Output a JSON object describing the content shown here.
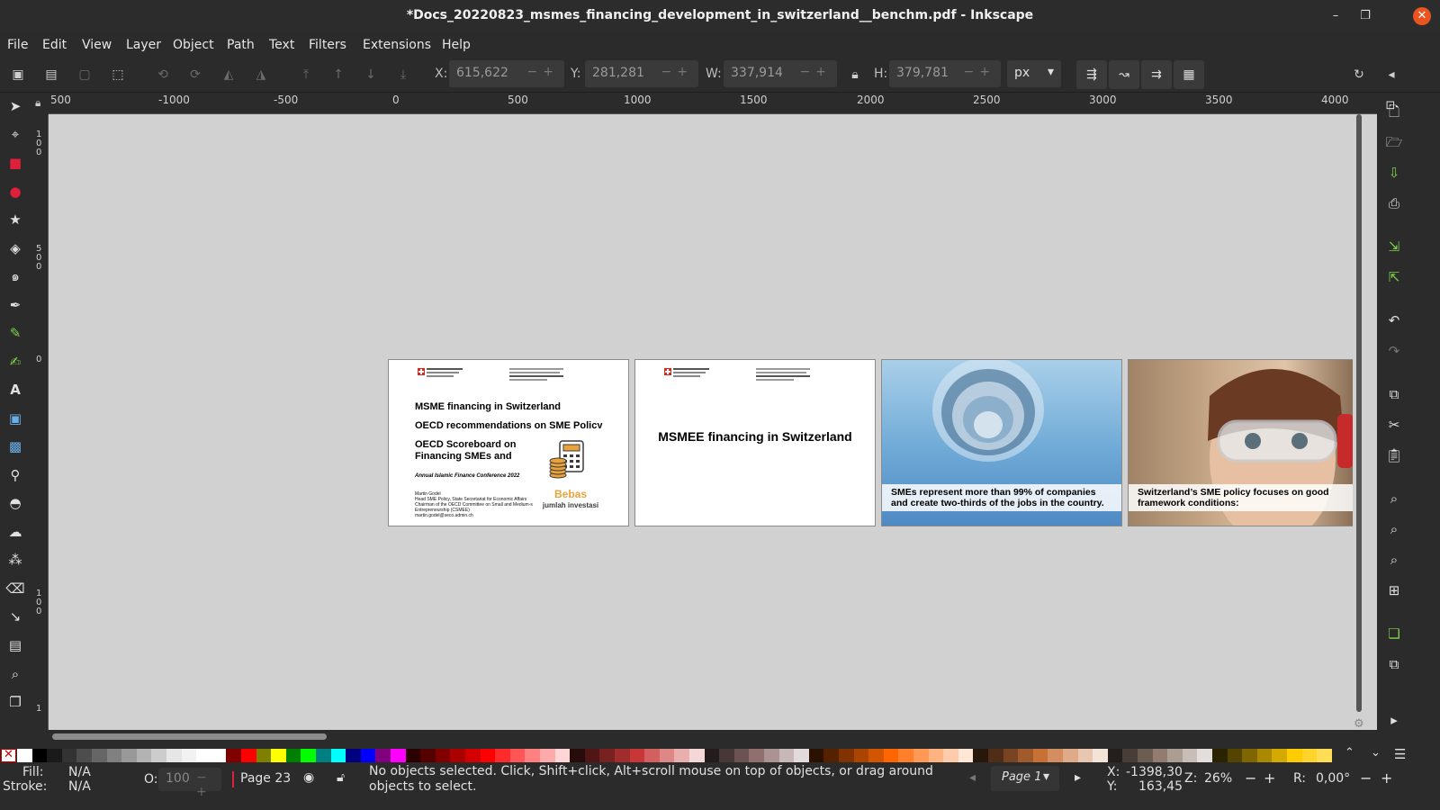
{
  "window": {
    "title": "*Docs_20220823_msmes_financing_development_in_switzerland__benchm.pdf - Inkscape",
    "controls": [
      "–",
      "❐",
      "✕"
    ]
  },
  "menu": [
    "File",
    "Edit",
    "View",
    "Layer",
    "Object",
    "Path",
    "Text",
    "Filters",
    "Extensions",
    "Help"
  ],
  "toolbar": {
    "x_label": "X:",
    "x_value": "615,622",
    "y_label": "Y:",
    "y_value": "281,281",
    "w_label": "W:",
    "w_value": "337,914",
    "h_label": "H:",
    "h_value": "379,781",
    "unit": "px"
  },
  "ruler": {
    "h_labels": [
      "500",
      "-1000",
      "-500",
      "0",
      "500",
      "1000",
      "1500",
      "2000",
      "2500",
      "3000",
      "3500",
      "4000"
    ],
    "v_labels": [
      "100",
      "500",
      "0",
      "100",
      "1"
    ]
  },
  "pages": [
    {
      "title1": "MSME financing in Switzerland",
      "title2": "OECD recommendations on SME Policy",
      "title3": "OECD Scoreboard on Financing SMEs and Entrepreneurs",
      "conference": "Annual Islamic Finance Conference 2022",
      "author_lines": [
        "Martin Godel",
        "Head SME Policy, State Secretariat for Economic Affairs",
        "Chairman of the OECD Committee on Small and Medium-sized",
        "Entrepreneurship (CSMEE)",
        "martin.godel@seco.admin.ch"
      ],
      "ad_title": "Bebas",
      "ad_sub": "jumlah investasi"
    },
    {
      "title": "MSMEE financing in Switzerland"
    },
    {
      "caption": "SMEs represent more than 99% of companies and create two-thirds of the jobs in the country."
    },
    {
      "caption": "Switzerland’s SME policy focuses on good framework conditions:"
    }
  ],
  "palette_colors": [
    "#ffffff",
    "#000000",
    "#1a1a1a",
    "#333333",
    "#4d4d4d",
    "#666666",
    "#808080",
    "#999999",
    "#b3b3b3",
    "#cccccc",
    "#e6e6e6",
    "#f2f2f2",
    "#ffffff",
    "#ffffff",
    "#800000",
    "#ff0000",
    "#808000",
    "#ffff00",
    "#008000",
    "#00ff00",
    "#008080",
    "#00ffff",
    "#000080",
    "#0000ff",
    "#800080",
    "#ff00ff",
    "#2b0000",
    "#550000",
    "#800000",
    "#aa0000",
    "#d40000",
    "#ff0000",
    "#ff2a2a",
    "#ff5555",
    "#ff8080",
    "#ffaaaa",
    "#ffd5d5",
    "#280b0b",
    "#501616",
    "#782121",
    "#a02c2c",
    "#c83737",
    "#d35f5f",
    "#de8787",
    "#e9afaf",
    "#f4d7d7",
    "#241c1c",
    "#483737",
    "#6c5353",
    "#916f6f",
    "#ac9393",
    "#c8b7b7",
    "#e3dbdb",
    "#2b1100",
    "#552200",
    "#803300",
    "#aa4400",
    "#d45500",
    "#ff6600",
    "#ff7f2a",
    "#ff9955",
    "#ffb380",
    "#ffccaa",
    "#ffe6d5",
    "#28170b",
    "#502d16",
    "#784421",
    "#a05a2c",
    "#c87137",
    "#d38d5f",
    "#deaa87",
    "#e9c6af",
    "#f4e3d7",
    "#241f1c",
    "#483e37",
    "#6c5d53",
    "#917c6f",
    "#ac9d93",
    "#c8beb7",
    "#e3dedb",
    "#2b2200",
    "#554400",
    "#806600",
    "#aa8800",
    "#d4aa00",
    "#ffcc00",
    "#ffd42a",
    "#ffdd55"
  ],
  "status": {
    "fill_label": "Fill:",
    "fill_value": "N/A",
    "stroke_label": "Stroke:",
    "stroke_value": "N/A",
    "opacity_label": "O:",
    "opacity_value": "100",
    "layer": "Page 23",
    "message": "No objects selected. Click, Shift+click, Alt+scroll mouse on top of objects, or drag around objects to select.",
    "page_select": "Page 1",
    "x_label": "X:",
    "x_value": "-1398,30",
    "y_label": "Y:",
    "y_value": "163,45",
    "zoom_label": "Z:",
    "zoom_value": "26%",
    "rot_label": "R:",
    "rot_value": "0,00°"
  }
}
